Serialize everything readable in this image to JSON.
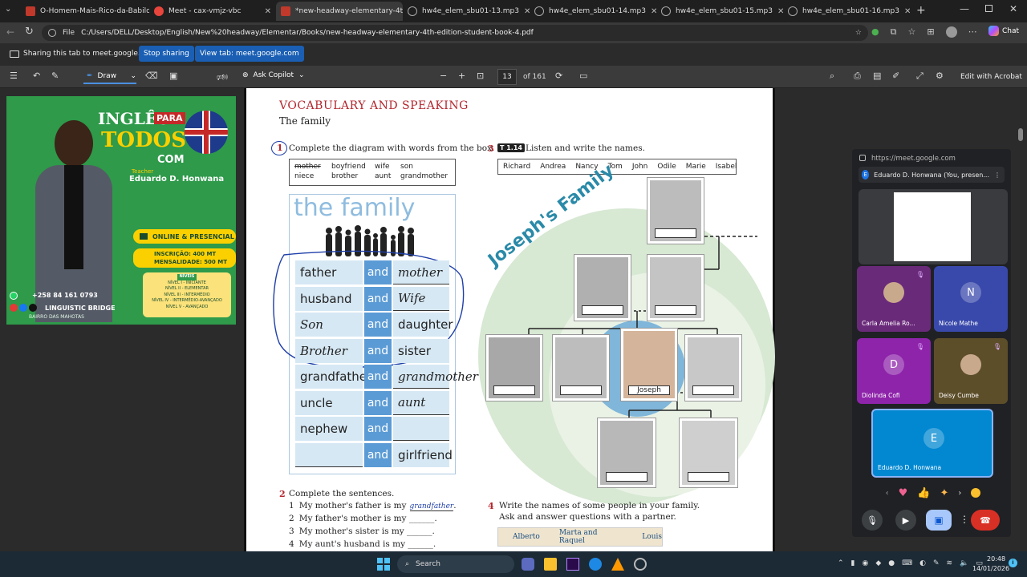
{
  "tabs": [
    {
      "label": "O-Homem-Mais-Rico-da-Babilonia",
      "color": "#c0392b"
    },
    {
      "label": "Meet - cax-vmjz-vbc",
      "color": "#e8453c"
    },
    {
      "label": "*new-headway-elementary-4t",
      "color": "#c0392b"
    },
    {
      "label": "hw4e_elem_sbu01-13.mp3",
      "color": "#888888"
    },
    {
      "label": "hw4e_elem_sbu01-14.mp3",
      "color": "#888888"
    },
    {
      "label": "hw4e_elem_sbu01-15.mp3",
      "color": "#888888"
    },
    {
      "label": "hw4e_elem_sbu01-16.mp3",
      "color": "#888888"
    }
  ],
  "address": {
    "scheme": "File",
    "url": "C:/Users/DELL/Desktop/English/New%20headway/Elementar/Books/new-headway-elementary-4th-edition-student-book-4.pdf",
    "chat": "Chat"
  },
  "share": {
    "text": "Sharing this tab to meet.google.com",
    "stop": "Stop sharing",
    "view": "View tab: meet.google.com"
  },
  "pdf_toolbar": {
    "draw": "Draw",
    "copilot": "Ask Copilot",
    "page": "13",
    "of": "of 161",
    "edit": "Edit with Acrobat"
  },
  "ad": {
    "title1": "INGLÊS",
    "title2": "PARA",
    "title3": "TODOS",
    "title4": "COM",
    "teacher_label": "Teacher",
    "teacher": "Eduardo D. Honwana",
    "mode": "ONLINE & PRESENCIAL",
    "insc_label": "INSCRIÇÃO:",
    "insc_val": "400 MT",
    "mens_label": "MENSALIDADE:",
    "mens_val": "500 MT",
    "levels_title": "NÍVEIS",
    "levels": [
      "NÍVEL I - INICIANTE",
      "NÍVEL II - ELEMENTAR",
      "NÍVEL III - INTERMÉDIO",
      "NÍVEL IV - INTERMÉDIO-AVANÇADO",
      "NÍVEL V - AVANÇADO"
    ],
    "phone": "+258 84 161 0793",
    "brand": "LINGUISTIC BRIDGE",
    "place": "BAIRRO DAS MAHOTAS"
  },
  "book": {
    "heading": "VOCABULARY AND SPEAKING",
    "subheading": "The family",
    "ex1_num": "1",
    "ex1_text": "Complete the diagram with words from the box.",
    "box_row1": [
      "mother",
      "boyfriend",
      "wife",
      "son"
    ],
    "box_row2": [
      "niece",
      "brother",
      "aunt",
      "grandmother"
    ],
    "diagram_title": "the family",
    "and": "and",
    "rows": [
      {
        "left": "father",
        "right": "mother",
        "left_hand": false,
        "right_hand": true
      },
      {
        "left": "husband",
        "right": "Wife",
        "left_hand": false,
        "right_hand": true
      },
      {
        "left": "Son",
        "right": "daughter",
        "left_hand": true,
        "right_hand": false
      },
      {
        "left": "Brother",
        "right": "sister",
        "left_hand": true,
        "right_hand": false
      },
      {
        "left": "grandfather",
        "right": "grandmother",
        "left_hand": false,
        "right_hand": true
      },
      {
        "left": "uncle",
        "right": "aunt",
        "left_hand": false,
        "right_hand": true
      },
      {
        "left": "nephew",
        "right": "",
        "left_hand": false,
        "right_hand": false
      },
      {
        "left": "",
        "right": "girlfriend",
        "left_hand": false,
        "right_hand": false
      }
    ],
    "ex3_num": "3",
    "ex3_badge": "T 1.14",
    "ex3_text": "Listen and write the names.",
    "names": [
      "Richard",
      "Andrea",
      "Nancy",
      "Tom",
      "John",
      "Odile",
      "Marie",
      "Isabel"
    ],
    "tree_title": "Joseph's Family",
    "joseph": "Joseph",
    "ex2_num": "2",
    "ex2_text": "Complete the sentences.",
    "sentences": [
      {
        "n": "1",
        "text": "My mother's father is my",
        "answer": "grandfather",
        "end": "."
      },
      {
        "n": "2",
        "text": "My father's mother is my ______.",
        "answer": "",
        "end": ""
      },
      {
        "n": "3",
        "text": "My mother's sister is my ______.",
        "answer": "",
        "end": ""
      },
      {
        "n": "4",
        "text": "My aunt's husband is my ______.",
        "answer": "",
        "end": ""
      }
    ],
    "ex4_num": "4",
    "ex4_text1": "Write the names of some people in your family.",
    "ex4_text2": "Ask and answer questions with a partner.",
    "ex4_names": [
      "Alberto",
      "Marta and Raquel",
      "Louis"
    ]
  },
  "meet": {
    "url": "https://meet.google.com",
    "presenter": "Eduardo D. Honwana (You, presen...",
    "participants": [
      {
        "name": "Carla Amelia Ro...",
        "initial": "",
        "color": "#6a2a7a"
      },
      {
        "name": "Nicole Mathe",
        "initial": "N",
        "color": "#3949ab"
      },
      {
        "name": "Diolinda Cofi",
        "initial": "D",
        "color": "#8e24aa"
      },
      {
        "name": "Deisy Cumbe",
        "initial": "",
        "color": "#5d4e2a"
      },
      {
        "name": "Eduardo D. Honwana",
        "initial": "E",
        "color": "#0288d1"
      }
    ]
  },
  "taskbar": {
    "search": "Search",
    "time": "20:48",
    "date": "14/01/2026"
  }
}
